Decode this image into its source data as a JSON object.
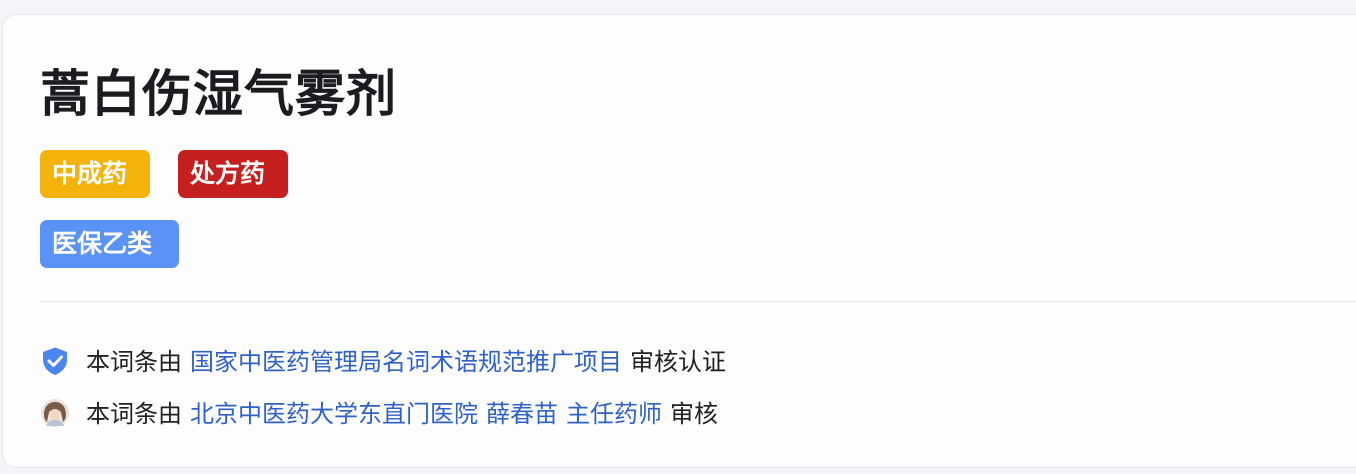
{
  "entry": {
    "title": "蒿白伤湿气雾剂",
    "tags": [
      {
        "label": "中成药",
        "color": "#f4b30b"
      },
      {
        "label": "处方药",
        "color": "#c61f1f"
      },
      {
        "label": "医保乙类",
        "color": "#5a93f5"
      }
    ]
  },
  "certification": {
    "icon": "verified-shield-icon",
    "prefix": "本词条由",
    "organization": "国家中医药管理局名词术语规范推广项目",
    "suffix": "审核认证"
  },
  "reviewer": {
    "icon": "reviewer-avatar",
    "prefix": "本词条由",
    "hospital": "北京中医药大学东直门医院",
    "name": "薛春苗",
    "title": "主任药师",
    "suffix": "审核"
  },
  "colors": {
    "link": "#2f62c8",
    "text": "#202124"
  }
}
